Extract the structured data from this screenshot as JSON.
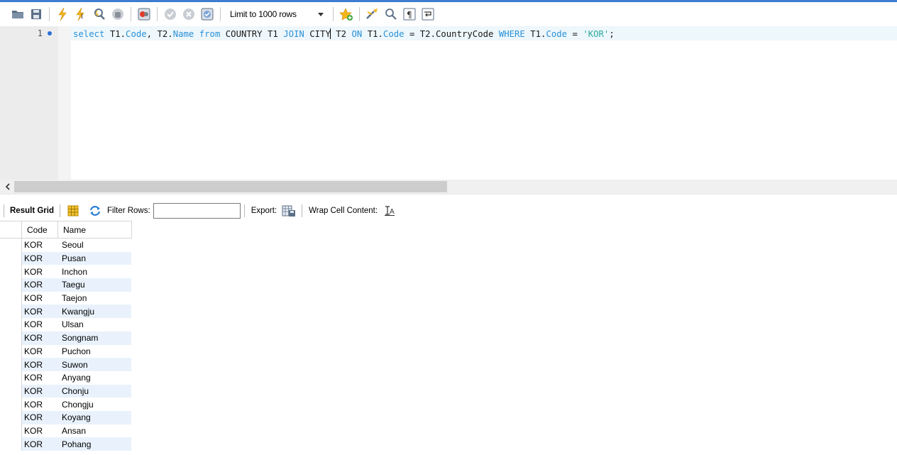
{
  "toolbar": {
    "limit_label": "Limit to 1000 rows",
    "icons": [
      "open-file-icon",
      "save-icon",
      "execute-icon",
      "execute-current-icon",
      "explain-icon",
      "stop-icon",
      "toggle-error-icon",
      "commit-icon",
      "rollback-icon",
      "autocommit-icon",
      "add-snippet-icon",
      "beautify-icon",
      "find-icon",
      "invisible-chars-icon",
      "wrap-icon"
    ]
  },
  "editor": {
    "line_number": "1",
    "code_tokens": {
      "t1": "select",
      "t2": " T1.",
      "t3": "Code",
      "t4": ", T2.",
      "t5": "Name",
      "t6": " ",
      "t7": "from",
      "t8": " COUNTRY T1 ",
      "t9": "JOIN",
      "t10": " CITY",
      "t11": " T2 ",
      "t12": "ON",
      "t13": " T1.",
      "t14": "Code",
      "t15": " = T2.CountryCode ",
      "t16": "WHERE",
      "t17": " T1.",
      "t18": "Code",
      "t19": " = ",
      "t20": "'KOR'",
      "t21": ";"
    }
  },
  "result_toolbar": {
    "result_grid_label": "Result Grid",
    "filter_rows_label": "Filter Rows:",
    "filter_value": "",
    "export_label": "Export:",
    "wrap_label": "Wrap Cell Content:"
  },
  "grid": {
    "columns": [
      "Code",
      "Name"
    ],
    "rows": [
      [
        "KOR",
        "Seoul"
      ],
      [
        "KOR",
        "Pusan"
      ],
      [
        "KOR",
        "Inchon"
      ],
      [
        "KOR",
        "Taegu"
      ],
      [
        "KOR",
        "Taejon"
      ],
      [
        "KOR",
        "Kwangju"
      ],
      [
        "KOR",
        "Ulsan"
      ],
      [
        "KOR",
        "Songnam"
      ],
      [
        "KOR",
        "Puchon"
      ],
      [
        "KOR",
        "Suwon"
      ],
      [
        "KOR",
        "Anyang"
      ],
      [
        "KOR",
        "Chonju"
      ],
      [
        "KOR",
        "Chongju"
      ],
      [
        "KOR",
        "Koyang"
      ],
      [
        "KOR",
        "Ansan"
      ],
      [
        "KOR",
        "Pohang"
      ]
    ]
  },
  "colors": {
    "keyword": "#2a91d8",
    "string": "#2aa89a",
    "row_alt": "#e9f2fc",
    "accent": "#3c7ed0"
  }
}
